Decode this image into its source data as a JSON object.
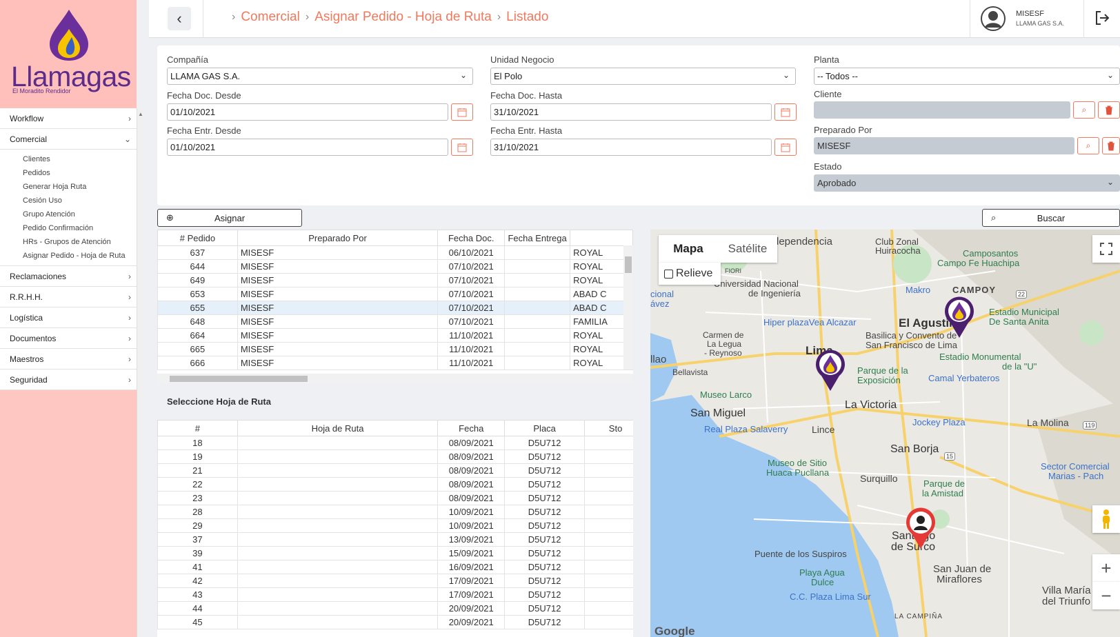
{
  "brand": {
    "name": "Llamagas",
    "tagline": "El Moradito Rendidor"
  },
  "colors": {
    "accent": "#f0795e",
    "sidebar": "#ffc7c2",
    "brand_purple": "#5b2c8a"
  },
  "sidebar": {
    "items": [
      {
        "label": "Workflow",
        "icon": "chevron-right-icon"
      },
      {
        "label": "Comercial",
        "icon": "chevron-down-icon"
      },
      {
        "label": "Reclamaciones",
        "icon": "chevron-right-icon"
      },
      {
        "label": "R.R.H.H.",
        "icon": "chevron-right-icon"
      },
      {
        "label": "Logística",
        "icon": "chevron-right-icon"
      },
      {
        "label": "Documentos",
        "icon": "chevron-right-icon"
      },
      {
        "label": "Maestros",
        "icon": "chevron-right-icon"
      },
      {
        "label": "Seguridad",
        "icon": "chevron-right-icon"
      }
    ],
    "comercial_sub": [
      "Clientes",
      "Pedidos",
      "Generar Hoja Ruta",
      "Cesión Uso",
      "Grupo Atención",
      "Pedido Confirmación",
      "HRs - Grupos de Atención",
      "Asignar Pedido - Hoja de Ruta"
    ]
  },
  "header": {
    "breadcrumb": [
      "Comercial",
      "Asignar Pedido - Hoja de Ruta",
      "Listado"
    ],
    "user_name": "MISESF",
    "user_company": "LLAMA GAS S.A."
  },
  "filters": {
    "compania_label": "Compañía",
    "compania_value": "LLAMA GAS S.A.",
    "unidad_label": "Unidad Negocio",
    "unidad_value": "El Polo",
    "planta_label": "Planta",
    "planta_value": "-- Todos --",
    "fdoc_desde_label": "Fecha Doc. Desde",
    "fdoc_desde_value": "01/10/2021",
    "fdoc_hasta_label": "Fecha Doc. Hasta",
    "fdoc_hasta_value": "31/10/2021",
    "cliente_label": "Cliente",
    "cliente_value": "",
    "fentr_desde_label": "Fecha Entr. Desde",
    "fentr_desde_value": "01/10/2021",
    "fentr_hasta_label": "Fecha Entr. Hasta",
    "fentr_hasta_value": "31/10/2021",
    "preparado_label": "Preparado Por",
    "preparado_value": "MISESF",
    "estado_label": "Estado",
    "estado_value": "Aprobado"
  },
  "actions": {
    "asignar": "Asignar",
    "buscar": "Buscar"
  },
  "pedidos": {
    "headers": [
      "# Pedido",
      "Preparado Por",
      "Fecha Doc.",
      "Fecha Entrega",
      ""
    ],
    "rows": [
      [
        "637",
        "MISESF",
        "06/10/2021",
        "",
        "ROYAL"
      ],
      [
        "644",
        "MISESF",
        "07/10/2021",
        "",
        "ROYAL"
      ],
      [
        "649",
        "MISESF",
        "07/10/2021",
        "",
        "ROYAL"
      ],
      [
        "653",
        "MISESF",
        "07/10/2021",
        "",
        "ABAD C"
      ],
      [
        "655",
        "MISESF",
        "07/10/2021",
        "",
        "ABAD C"
      ],
      [
        "648",
        "MISESF",
        "07/10/2021",
        "",
        "FAMILIA"
      ],
      [
        "664",
        "MISESF",
        "11/10/2021",
        "",
        "ROYAL"
      ],
      [
        "665",
        "MISESF",
        "11/10/2021",
        "",
        "ROYAL"
      ],
      [
        "666",
        "MISESF",
        "11/10/2021",
        "",
        "ROYAL"
      ]
    ],
    "selected_index": 4
  },
  "hojas": {
    "title": "Seleccione Hoja de Ruta",
    "headers": [
      "#",
      "Hoja de Ruta",
      "Fecha",
      "Placa",
      "Sto"
    ],
    "rows": [
      [
        "18",
        "",
        "08/09/2021",
        "D5U712",
        ""
      ],
      [
        "19",
        "",
        "08/09/2021",
        "D5U712",
        ""
      ],
      [
        "21",
        "",
        "08/09/2021",
        "D5U712",
        ""
      ],
      [
        "22",
        "",
        "08/09/2021",
        "D5U712",
        ""
      ],
      [
        "23",
        "",
        "08/09/2021",
        "D5U712",
        ""
      ],
      [
        "28",
        "",
        "10/09/2021",
        "D5U712",
        ""
      ],
      [
        "29",
        "",
        "10/09/2021",
        "D5U712",
        ""
      ],
      [
        "37",
        "",
        "13/09/2021",
        "D5U712",
        ""
      ],
      [
        "39",
        "",
        "15/09/2021",
        "D5U712",
        ""
      ],
      [
        "41",
        "",
        "16/09/2021",
        "D5U712",
        ""
      ],
      [
        "42",
        "",
        "17/09/2021",
        "D5U712",
        ""
      ],
      [
        "43",
        "",
        "17/09/2021",
        "D5U712",
        ""
      ],
      [
        "44",
        "",
        "20/09/2021",
        "D5U712",
        ""
      ],
      [
        "45",
        "",
        "20/09/2021",
        "D5U712",
        ""
      ]
    ]
  },
  "map": {
    "type_mapa": "Mapa",
    "type_satelite": "Satélite",
    "relieve": "Relieve",
    "labels": {
      "l1": "Club Zonal",
      "l2": "Huiracocha",
      "l3": "Camposantos",
      "l4": "Campo Fe Huachipa",
      "l5": "dependencia",
      "l6": "Universidad Nacional",
      "l7": "de Ingeniería",
      "l8": "Makro",
      "l9": "CAMPOY",
      "l10": "El Agustino",
      "l11": "Estadio Municipal",
      "l12": "De Santa Anita",
      "l13": "Hiper plazaVea Alcazar",
      "l14": "Basilica y Convento de",
      "l15": "San Francisco de Lima",
      "l16": "Carmen de",
      "l17": "La Legua",
      "l18": "- Reynoso",
      "l19": "Lima",
      "l20": "Estadio Monumental",
      "l21": "de la \"U\"",
      "l22": "llao",
      "l23": "Bellavista",
      "l24": "Parque de la",
      "l25": "Exposición",
      "l26": "Camal Yerbateros",
      "l27": "Museo Larco",
      "l28": "La Victoria",
      "l29": "San Miguel",
      "l30": "Jockey Plaza",
      "l31": "Real Plaza Salaverry",
      "l32": "Lince",
      "l33": "La Molina",
      "l34": "San Borja",
      "l35": "Museo de Sitio",
      "l36": "Huaca Pucllana",
      "l37": "Surquillo",
      "l38": "Parque de",
      "l39": "la Amistad",
      "l40": "Sector Comercial",
      "l41": "Marias - Pach",
      "l42": "Santiago",
      "l43": "de Surco",
      "l44": "Puente de los Suspiros",
      "l45": "San Juan de",
      "l46": "Miraflores",
      "l47": "Playa Agua",
      "l48": "Dulce",
      "l49": "C.C. Plaza Lima Sur",
      "l50": "Villa María",
      "l51": "del Triunfo",
      "l52": "LA CAMPIÑA",
      "l53": "Google",
      "l54": "cional",
      "l55": "ávez",
      "l56": "FIORI",
      "l57": "22",
      "l58": "119",
      "l59": "15"
    }
  }
}
